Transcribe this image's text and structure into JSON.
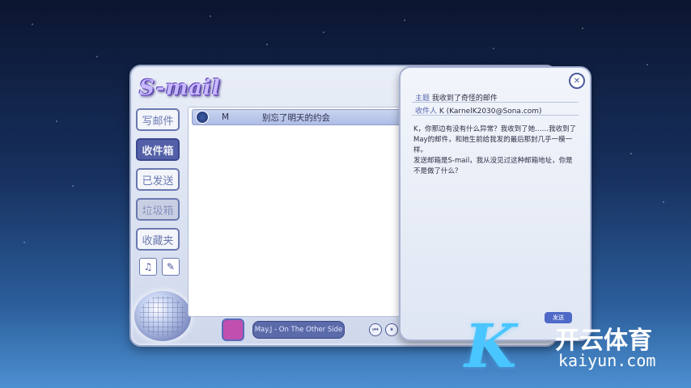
{
  "app": {
    "logo_text": "S-mail"
  },
  "sidebar": {
    "items": [
      {
        "label": "写邮件",
        "state": "normal"
      },
      {
        "label": "收件箱",
        "state": "active"
      },
      {
        "label": "已发送",
        "state": "normal"
      },
      {
        "label": "垃圾箱",
        "state": "dim"
      },
      {
        "label": "收藏夹",
        "state": "normal"
      }
    ]
  },
  "mail_list": {
    "rows": [
      {
        "sender": "M",
        "subject": "别忘了明天的约会"
      }
    ]
  },
  "player": {
    "song": "May.J - On The Other Side",
    "prev_icon": "skip-back-icon",
    "pause_icon": "pause-icon"
  },
  "compose": {
    "subject_label": "主题",
    "subject": "我收到了奇怪的邮件",
    "recipient_label": "收件人",
    "recipient": "K (KarnelK2030@Sona.com)",
    "body": [
      "K，你那边有没有什么异常？我收到了她……我收到了May的邮件，和她生前给我发的最后那封几乎一模一样。",
      "发送邮箱是S-mail，我从没见过这种邮箱地址，你是不是做了什么？"
    ],
    "send_label": "发送",
    "close_icon": "close-icon"
  },
  "watermark": {
    "title": "开云体育",
    "url": "kaiyun.com",
    "letter": "K"
  },
  "colors": {
    "accent": "#5360a8",
    "panel": "#e9eef8",
    "watermark": "#49c6ff"
  }
}
